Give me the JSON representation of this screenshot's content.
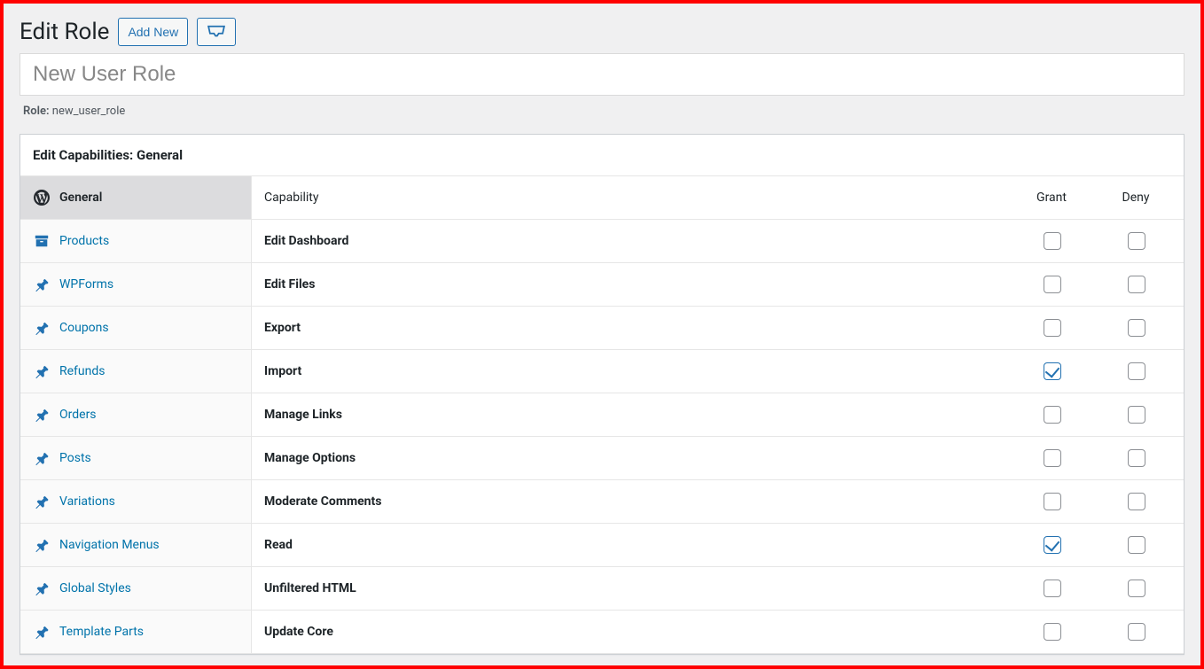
{
  "header": {
    "title": "Edit Role",
    "add_new_label": "Add New"
  },
  "role_name_input_value": "New User Role",
  "role_slug_label": "Role:",
  "role_slug_value": "new_user_role",
  "panel_title": "Edit Capabilities: General",
  "sidebar": {
    "items": [
      {
        "label": "General",
        "icon": "wordpress-icon",
        "active": true
      },
      {
        "label": "Products",
        "icon": "archive-icon",
        "active": false
      },
      {
        "label": "WPForms",
        "icon": "pin-icon",
        "active": false
      },
      {
        "label": "Coupons",
        "icon": "pin-icon",
        "active": false
      },
      {
        "label": "Refunds",
        "icon": "pin-icon",
        "active": false
      },
      {
        "label": "Orders",
        "icon": "pin-icon",
        "active": false
      },
      {
        "label": "Posts",
        "icon": "pin-icon",
        "active": false
      },
      {
        "label": "Variations",
        "icon": "pin-icon",
        "active": false
      },
      {
        "label": "Navigation Menus",
        "icon": "pin-icon",
        "active": false
      },
      {
        "label": "Global Styles",
        "icon": "pin-icon",
        "active": false
      },
      {
        "label": "Template Parts",
        "icon": "pin-icon",
        "active": false
      }
    ]
  },
  "cap_table": {
    "col_capability": "Capability",
    "col_grant": "Grant",
    "col_deny": "Deny",
    "rows": [
      {
        "name": "Edit Dashboard",
        "grant": false,
        "deny": false
      },
      {
        "name": "Edit Files",
        "grant": false,
        "deny": false
      },
      {
        "name": "Export",
        "grant": false,
        "deny": false
      },
      {
        "name": "Import",
        "grant": true,
        "deny": false
      },
      {
        "name": "Manage Links",
        "grant": false,
        "deny": false
      },
      {
        "name": "Manage Options",
        "grant": false,
        "deny": false
      },
      {
        "name": "Moderate Comments",
        "grant": false,
        "deny": false
      },
      {
        "name": "Read",
        "grant": true,
        "deny": false
      },
      {
        "name": "Unfiltered HTML",
        "grant": false,
        "deny": false
      },
      {
        "name": "Update Core",
        "grant": false,
        "deny": false
      }
    ]
  }
}
